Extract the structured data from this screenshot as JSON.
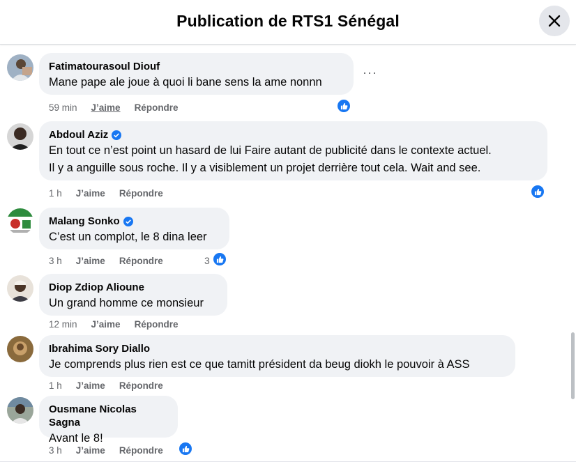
{
  "header": {
    "title": "Publication de RTS1 Sénégal"
  },
  "actions": {
    "like_label": "J’aime",
    "reply_label": "Répondre"
  },
  "comments": [
    {
      "author": "Fatimatourasoul Diouf",
      "text": [
        "Mane pape ale joue à quoi li bane sens la ame nonnn"
      ],
      "time": "59 min",
      "verified": false,
      "reactions": ""
    },
    {
      "author": "Abdoul Aziz",
      "text": [
        "En tout ce n’est point un hasard de lui Faire autant de publicité dans le contexte actuel.",
        "Il y a anguille sous roche. Il y a visiblement un projet derrière tout cela. Wait and see."
      ],
      "time": "1 h",
      "verified": true,
      "reactions": ""
    },
    {
      "author": "Malang Sonko",
      "text": [
        "C’est un complot, le 8 dina leer"
      ],
      "time": "3 h",
      "verified": true,
      "reactions": "3"
    },
    {
      "author": "Diop Zdiop Alioune",
      "text": [
        "Un grand homme ce monsieur"
      ],
      "time": "12 min",
      "verified": false,
      "reactions": ""
    },
    {
      "author": "Ibrahima Sory Diallo",
      "text": [
        "Je comprends plus rien est ce que tamitt président da beug diokh le pouvoir à ASS"
      ],
      "time": "1 h",
      "verified": false,
      "reactions": ""
    },
    {
      "author": "Ousmane Nicolas Sagna",
      "text": [
        "Avant le 8!"
      ],
      "time": "3 h",
      "verified": false,
      "reactions": ""
    }
  ],
  "colors": {
    "accent": "#1877f2",
    "bubble": "#f0f2f5",
    "muted": "#65676b"
  }
}
